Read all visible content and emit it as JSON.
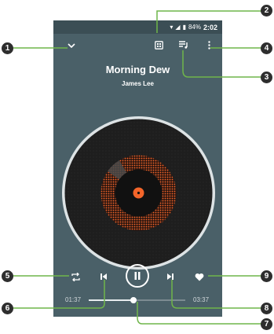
{
  "status_bar": {
    "battery": "84%",
    "time": "2:02"
  },
  "song": {
    "title": "Morning Dew",
    "artist": "James Lee"
  },
  "seek": {
    "elapsed": "01:37",
    "remaining": "03:37",
    "progress": 0.46
  },
  "callouts": [
    "1",
    "2",
    "3",
    "4",
    "5",
    "6",
    "7",
    "8",
    "9"
  ],
  "colors": {
    "screen_bg": "#4a6068",
    "accent": "#f3652a",
    "callout_line": "#6fb54a"
  },
  "icons": [
    "chevron-down-icon",
    "gallery-icon",
    "playlist-icon",
    "more-icon",
    "repeat-icon",
    "previous-icon",
    "pause-icon",
    "next-icon",
    "heart-icon"
  ]
}
